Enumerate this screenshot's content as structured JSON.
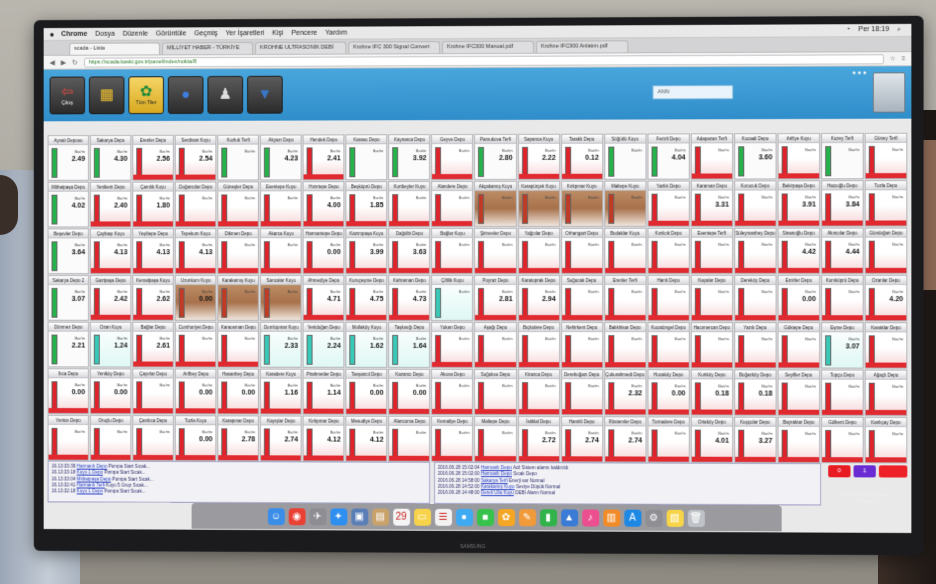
{
  "menubar": {
    "items": [
      "Chrome",
      "Dosya",
      "Düzenle",
      "Görüntüle",
      "Geçmiş",
      "Yer İşaretleri",
      "Kişi",
      "Pencere",
      "Yardım"
    ],
    "clock": "Per 18:19"
  },
  "tabs": [
    {
      "label": "scada - Lista"
    },
    {
      "label": "MİLLİYET HABER - TÜRKİYE"
    },
    {
      "label": "KROHNE ULTRASONİK DEBİ"
    },
    {
      "label": "Krohne IFC 300 Signal Convert"
    },
    {
      "label": "Krohne IFC300 Manual.pdf"
    },
    {
      "label": "Krohne IFC300 Anlatım.pdf"
    }
  ],
  "url": "https://scada.kaski.gov.tr/panel/index/nokta/8",
  "toolbar": {
    "search_value": "ANN",
    "buttons": [
      {
        "label": "Çıkış",
        "icon": "exit-icon",
        "glyph": "⇦"
      },
      {
        "label": "",
        "icon": "tree-icon",
        "glyph": "▦"
      },
      {
        "label": "Tüm Tiler",
        "icon": "network-icon",
        "glyph": "✿"
      },
      {
        "label": "",
        "icon": "map-pin-icon",
        "glyph": "●"
      },
      {
        "label": "",
        "icon": "user-icon",
        "glyph": "♟"
      },
      {
        "label": "",
        "icon": "filter-icon",
        "glyph": "▼"
      }
    ]
  },
  "tiles": [
    {
      "name": "Ayvalı Deposu",
      "value": "2.49",
      "state": "green"
    },
    {
      "name": "Sakarya Depo",
      "value": "4.30",
      "state": "green"
    },
    {
      "name": "Erenler Depo",
      "value": "2.56",
      "state": "red"
    },
    {
      "name": "Serdivan Kuyu",
      "value": "2.54",
      "state": "red"
    },
    {
      "name": "Kozluk Terfi",
      "value": "",
      "state": "green"
    },
    {
      "name": "Akyazı Depo",
      "value": "4.23",
      "state": "green"
    },
    {
      "name": "Hendek Depo",
      "value": "2.41",
      "state": "red"
    },
    {
      "name": "Karasu Depo",
      "value": "",
      "state": "green"
    },
    {
      "name": "Kaynarca Depo",
      "value": "3.92",
      "state": "green"
    },
    {
      "name": "Geyve Depo",
      "value": "",
      "state": "red"
    },
    {
      "name": "Pamukova Terfi",
      "value": "2.80",
      "state": "green"
    },
    {
      "name": "Sapanca Kuyu",
      "value": "2.22",
      "state": "red"
    },
    {
      "name": "Taraklı Depo",
      "value": "0.12",
      "state": "red"
    },
    {
      "name": "Söğütlü Kuyu",
      "value": "",
      "state": "green"
    },
    {
      "name": "Ferizli Depo",
      "value": "4.04",
      "state": "green"
    },
    {
      "name": "Adapazarı Terfi",
      "value": "",
      "state": "red"
    },
    {
      "name": "Kocaali Depo",
      "value": "3.60",
      "state": "green"
    },
    {
      "name": "Arifiye Kuyu",
      "value": "",
      "state": "red"
    },
    {
      "name": "Kuzey Terfi",
      "value": "",
      "state": "green"
    },
    {
      "name": "Güney Terfi",
      "value": "",
      "state": "red"
    },
    {
      "name": "Mithatpaşa Depo",
      "value": "4.02",
      "state": "green"
    },
    {
      "name": "Yenikent Depo",
      "value": "2.40",
      "state": "red"
    },
    {
      "name": "Çamlık Kuyu",
      "value": "1.80",
      "state": "red"
    },
    {
      "name": "Doğancılar Depo",
      "value": "",
      "state": "red"
    },
    {
      "name": "Güneşler Depo",
      "value": "",
      "state": "red"
    },
    {
      "name": "Esentepe Kuyu",
      "value": "",
      "state": "red"
    },
    {
      "name": "Hızırtepe Depo",
      "value": "4.00",
      "state": "red"
    },
    {
      "name": "Beşköprü Depo",
      "value": "1.85",
      "state": "red"
    },
    {
      "name": "Kurtbeyler Kuyu",
      "value": "",
      "state": "red"
    },
    {
      "name": "Alandere Depo",
      "value": "",
      "state": "red"
    },
    {
      "name": "Akçakamış Kuyu",
      "value": "",
      "state": "brown"
    },
    {
      "name": "Karapürçek Kuyu",
      "value": "",
      "state": "brown"
    },
    {
      "name": "Kırkpınar Kuyu",
      "value": "",
      "state": "brown"
    },
    {
      "name": "Maltepe Kuyu",
      "value": "",
      "state": "brown"
    },
    {
      "name": "Yazlık Depo",
      "value": "",
      "state": "red"
    },
    {
      "name": "Karaman Depo",
      "value": "3.31",
      "state": "red"
    },
    {
      "name": "Korucuk Depo",
      "value": "",
      "state": "red"
    },
    {
      "name": "Bekirpaşa Depo",
      "value": "3.91",
      "state": "red"
    },
    {
      "name": "Hacıoğlu Depo",
      "value": "3.84",
      "state": "red"
    },
    {
      "name": "Tuzla Depo",
      "value": "",
      "state": "red"
    },
    {
      "name": "Beşevler Depo",
      "value": "3.64",
      "state": "green"
    },
    {
      "name": "Çaybaşı Kuyu",
      "value": "4.13",
      "state": "red"
    },
    {
      "name": "Yeşiltepe Depo",
      "value": "4.13",
      "state": "red"
    },
    {
      "name": "Tepekum Kuyu",
      "value": "4.13",
      "state": "red"
    },
    {
      "name": "Dikmen Depo",
      "value": "",
      "state": "red"
    },
    {
      "name": "Akarca Kuyu",
      "value": "",
      "state": "red"
    },
    {
      "name": "Harmantepe Depo",
      "value": "0.00",
      "state": "red"
    },
    {
      "name": "Kazımpaşa Kuyu",
      "value": "3.99",
      "state": "red"
    },
    {
      "name": "Dağdibi Depo",
      "value": "3.63",
      "state": "red"
    },
    {
      "name": "Bağlar Kuyu",
      "value": "",
      "state": "red"
    },
    {
      "name": "Şirinevler Depo",
      "value": "",
      "state": "red"
    },
    {
      "name": "Yağcılar Depo",
      "value": "",
      "state": "red"
    },
    {
      "name": "Orhangazi Depo",
      "value": "",
      "state": "red"
    },
    {
      "name": "Budaklar Kuyu",
      "value": "",
      "state": "red"
    },
    {
      "name": "Kızılcık Depo",
      "value": "",
      "state": "red"
    },
    {
      "name": "Esentepe Terfi",
      "value": "",
      "state": "red"
    },
    {
      "name": "Süleymanbey Depo",
      "value": "",
      "state": "red"
    },
    {
      "name": "Sinanoğlu Depo",
      "value": "4.42",
      "state": "red"
    },
    {
      "name": "Akıncılar Depo",
      "value": "4.44",
      "state": "red"
    },
    {
      "name": "Gündoğan Depo",
      "value": "",
      "state": "red"
    },
    {
      "name": "Sakarya Depo 2",
      "value": "3.07",
      "state": "green"
    },
    {
      "name": "Gazipaşa Depo",
      "value": "2.42",
      "state": "red"
    },
    {
      "name": "Kemalpaşa Kuyu",
      "value": "2.62",
      "state": "red"
    },
    {
      "name": "Uzunkum Kuyu",
      "value": "0.00",
      "state": "brown"
    },
    {
      "name": "Karakamış Kuyu",
      "value": "",
      "state": "brown"
    },
    {
      "name": "Sarıcalar Kuyu",
      "value": "",
      "state": "brown"
    },
    {
      "name": "Ahmediye Depo",
      "value": "4.71",
      "state": "red"
    },
    {
      "name": "Kuruçeşme Depo",
      "value": "4.75",
      "state": "red"
    },
    {
      "name": "Kahraman Depo",
      "value": "4.73",
      "state": "red"
    },
    {
      "name": "Çiftlik Kuyu",
      "value": "",
      "state": "teal"
    },
    {
      "name": "Poyraz Depo",
      "value": "2.81",
      "state": "red"
    },
    {
      "name": "Karatoprak Depo",
      "value": "2.94",
      "state": "red"
    },
    {
      "name": "Soğucak Depo",
      "value": "",
      "state": "red"
    },
    {
      "name": "Erenler Terfi",
      "value": "",
      "state": "red"
    },
    {
      "name": "Hanlı Depo",
      "value": "",
      "state": "red"
    },
    {
      "name": "Kayalar Depo",
      "value": "",
      "state": "red"
    },
    {
      "name": "Dereköy Depo",
      "value": "",
      "state": "red"
    },
    {
      "name": "Emirler Depo",
      "value": "0.00",
      "state": "red"
    },
    {
      "name": "Kumköprü Depo",
      "value": "",
      "state": "red"
    },
    {
      "name": "Ozanlar Depo",
      "value": "4.20",
      "state": "red"
    },
    {
      "name": "Dönmez Depo",
      "value": "2.21",
      "state": "green"
    },
    {
      "name": "Ozan Kuyu",
      "value": "1.24",
      "state": "teal"
    },
    {
      "name": "Bağlar Depo",
      "value": "2.61",
      "state": "red"
    },
    {
      "name": "Cumhuriyet Depo",
      "value": "",
      "state": "red"
    },
    {
      "name": "Karaosman Depo",
      "value": "",
      "state": "red"
    },
    {
      "name": "Dumlupınar Kuyu",
      "value": "2.33",
      "state": "teal"
    },
    {
      "name": "Yenidoğan Depo",
      "value": "2.24",
      "state": "teal"
    },
    {
      "name": "Mollaköy Kuyu",
      "value": "1.62",
      "state": "teal"
    },
    {
      "name": "Taşkısığı Depo",
      "value": "1.64",
      "state": "teal"
    },
    {
      "name": "Yukarı Depo",
      "value": "",
      "state": "red"
    },
    {
      "name": "Aşağı Depo",
      "value": "",
      "state": "red"
    },
    {
      "name": "Bıçkıdere Depo",
      "value": "",
      "state": "red"
    },
    {
      "name": "Nehirkent Depo",
      "value": "",
      "state": "red"
    },
    {
      "name": "Balıkhisar Depo",
      "value": "",
      "state": "red"
    },
    {
      "name": "Kocatöngel Depo",
      "value": "",
      "state": "red"
    },
    {
      "name": "Hacımercan Depo",
      "value": "",
      "state": "red"
    },
    {
      "name": "Yazılı Depo",
      "value": "",
      "state": "red"
    },
    {
      "name": "Göktepe Depo",
      "value": "",
      "state": "red"
    },
    {
      "name": "Eşme Depo",
      "value": "3.07",
      "state": "teal"
    },
    {
      "name": "Kavaklar Depo",
      "value": "",
      "state": "red"
    },
    {
      "name": "Ilıca Depo",
      "value": "0.00",
      "state": "red"
    },
    {
      "name": "Yeniköy Depo",
      "value": "0.00",
      "state": "red"
    },
    {
      "name": "Çayırlar Depo",
      "value": "",
      "state": "red"
    },
    {
      "name": "Arifbey Depo",
      "value": "0.00",
      "state": "red"
    },
    {
      "name": "Hasanbey Depo",
      "value": "0.00",
      "state": "red"
    },
    {
      "name": "Karadere Kuyu",
      "value": "1.16",
      "state": "red"
    },
    {
      "name": "Pirahmetler Depo",
      "value": "1.14",
      "state": "red"
    },
    {
      "name": "Tavşancıl Depo",
      "value": "0.00",
      "state": "red"
    },
    {
      "name": "Kazancı Depo",
      "value": "0.00",
      "state": "red"
    },
    {
      "name": "Akova Depo",
      "value": "",
      "state": "red"
    },
    {
      "name": "Soğuksu Depo",
      "value": "",
      "state": "red"
    },
    {
      "name": "Kirazca Depo",
      "value": "",
      "state": "red"
    },
    {
      "name": "Dereboğazı Depo",
      "value": "",
      "state": "red"
    },
    {
      "name": "Çukurahmedi Depo",
      "value": "2.32",
      "state": "red"
    },
    {
      "name": "Hocaköy Depo",
      "value": "0.00",
      "state": "red"
    },
    {
      "name": "Kurtköy Depo",
      "value": "0.18",
      "state": "red"
    },
    {
      "name": "Boğazköy Depo",
      "value": "0.18",
      "state": "red"
    },
    {
      "name": "Seyifler Depo",
      "value": "",
      "state": "red"
    },
    {
      "name": "Topçu Depo",
      "value": "",
      "state": "red"
    },
    {
      "name": "Ağaçlı Depo",
      "value": "",
      "state": "red"
    },
    {
      "name": "Yenice Depo",
      "value": "",
      "state": "red"
    },
    {
      "name": "Oruçlu Depo",
      "value": "",
      "state": "red"
    },
    {
      "name": "Çamlıca Depo",
      "value": "",
      "state": "red"
    },
    {
      "name": "Tuzla Kuyu",
      "value": "0.00",
      "state": "red"
    },
    {
      "name": "Karapınar Depo",
      "value": "2.78",
      "state": "red"
    },
    {
      "name": "Kayışlar Depo",
      "value": "2.74",
      "state": "red"
    },
    {
      "name": "Kırkpınar Depo",
      "value": "4.12",
      "state": "red"
    },
    {
      "name": "Mesudiye Depo",
      "value": "4.12",
      "state": "red"
    },
    {
      "name": "Alancuma Depo",
      "value": "",
      "state": "red"
    },
    {
      "name": "Kemaliye Depo",
      "value": "",
      "state": "red"
    },
    {
      "name": "Maltepe Depo",
      "value": "",
      "state": "red"
    },
    {
      "name": "İstiklal Depo",
      "value": "2.72",
      "state": "red"
    },
    {
      "name": "Hamitli Depo",
      "value": "2.74",
      "state": "red"
    },
    {
      "name": "Rüstemler Depo",
      "value": "2.74",
      "state": "red"
    },
    {
      "name": "Turnadere Depo",
      "value": "",
      "state": "red"
    },
    {
      "name": "Ortaköy Depo",
      "value": "4.01",
      "state": "red"
    },
    {
      "name": "Kuşçular Depo",
      "value": "3.27",
      "state": "red"
    },
    {
      "name": "Bayraktar Depo",
      "value": "",
      "state": "red"
    },
    {
      "name": "Gölkent Depo",
      "value": "",
      "state": "red"
    },
    {
      "name": "Kanlıçay Depo",
      "value": "",
      "state": "red"
    }
  ],
  "log_left": [
    {
      "time": "16.13:33:39",
      "text": "Harmanlı Depo",
      "rest": "Pompa Start Sıcak..."
    },
    {
      "time": "16.13:33:18",
      "text": "Kuyu 1 Depo",
      "rest": "Pompa Start Sıcak..."
    },
    {
      "time": "16.13:33:04",
      "text": "Mithatpaşa Depo",
      "rest": "Pompa Start Sıcak..."
    },
    {
      "time": "16.13:32:41",
      "text": "Harmanlı Terfi",
      "rest": "Kuyu 5 Grup Sıcak..."
    },
    {
      "time": "16.13:32:18",
      "text": "Kuyu 1 Depo",
      "rest": "Pompa Start Sıcak..."
    }
  ],
  "log_right": [
    {
      "time": "2016.06.28 15:02:04",
      "text": "Harmanlı Depo",
      "rest": "Acil Sistem alarmı kaldırıldı"
    },
    {
      "time": "2016.06.28 15:02:00",
      "text": "Harmanlı Depo",
      "rest": "Sıcak Depo"
    },
    {
      "time": "2016.06.28 14:58:00",
      "text": "Sakarya Terfi",
      "rest": "Enerji var Normal"
    },
    {
      "time": "2016.06.28 14:52:00",
      "text": "Karakamış Kuyu",
      "rest": "Seviye Düşük Normal"
    },
    {
      "time": "2016.06.28 14:48:00",
      "text": "Dereli Ulla Kuyu",
      "rest": "DEBİ Alarm Normal"
    }
  ],
  "status_buttons": [
    {
      "label": "0",
      "color": "#e81a22"
    },
    {
      "label": "1",
      "color": "#6a2bd3"
    },
    {
      "label": "",
      "color": "#ee2129"
    }
  ],
  "dock": {
    "items": [
      {
        "icon": "finder-icon",
        "glyph": "☺",
        "color": "#3b8ee8"
      },
      {
        "icon": "chrome-icon",
        "glyph": "◉",
        "color": "#e94235"
      },
      {
        "icon": "launchpad-icon",
        "glyph": "✈",
        "color": "#8d8d93"
      },
      {
        "icon": "safari-icon",
        "glyph": "✦",
        "color": "#2f8ff0"
      },
      {
        "icon": "photos-icon",
        "glyph": "▣",
        "color": "#5a7eb6"
      },
      {
        "icon": "contacts-icon",
        "glyph": "▤",
        "color": "#c9a26b"
      },
      {
        "icon": "calendar-icon",
        "glyph": "29",
        "color": "#f4f4f4"
      },
      {
        "icon": "notes-icon",
        "glyph": "▭",
        "color": "#f7d34c"
      },
      {
        "icon": "reminders-icon",
        "glyph": "☰",
        "color": "#f2f2f2"
      },
      {
        "icon": "messages-icon",
        "glyph": "●",
        "color": "#3eaaf2"
      },
      {
        "icon": "facetime-icon",
        "glyph": "■",
        "color": "#37c24c"
      },
      {
        "icon": "photos2-icon",
        "glyph": "✿",
        "color": "#f5a623"
      },
      {
        "icon": "pages-icon",
        "glyph": "✎",
        "color": "#f09a3a"
      },
      {
        "icon": "numbers-icon",
        "glyph": "▮",
        "color": "#2fb34a"
      },
      {
        "icon": "keynote-icon",
        "glyph": "▲",
        "color": "#3a7bd5"
      },
      {
        "icon": "itunes-icon",
        "glyph": "♪",
        "color": "#ec4f8f"
      },
      {
        "icon": "ibooks-icon",
        "glyph": "▥",
        "color": "#f28c28"
      },
      {
        "icon": "appstore-icon",
        "glyph": "A",
        "color": "#1e88e5"
      },
      {
        "icon": "settings-icon",
        "glyph": "⚙",
        "color": "#8e8e93"
      },
      {
        "icon": "note-icon",
        "glyph": "▧",
        "color": "#f8d548"
      },
      {
        "icon": "trash-icon",
        "glyph": "🗑",
        "color": "#bfc3c7"
      }
    ]
  },
  "desktop_file_label": "dokulu-turk-bayragi-r169.jpeg"
}
